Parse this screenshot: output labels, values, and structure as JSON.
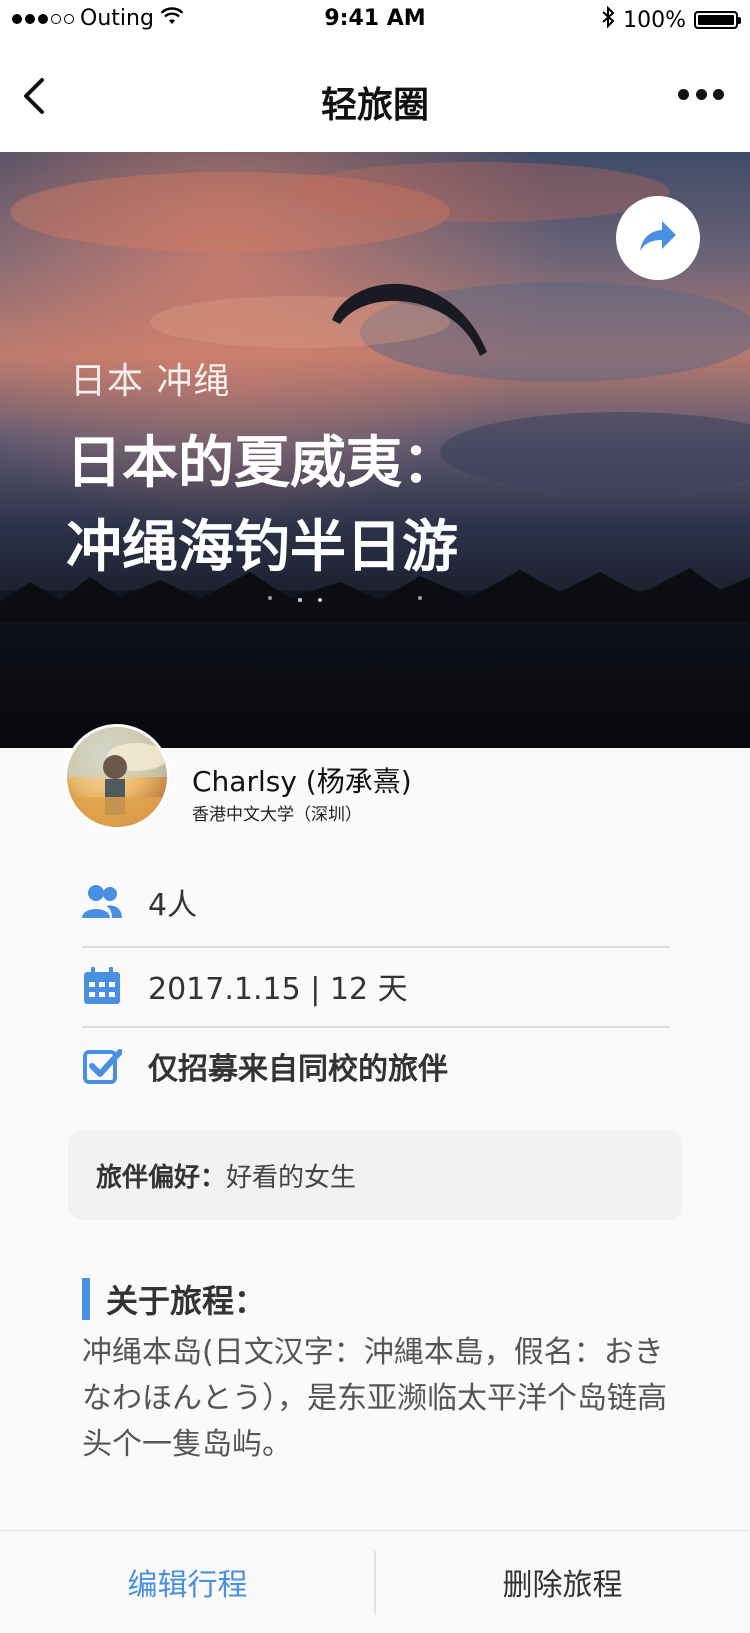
{
  "status_bar": {
    "carrier": "Outing",
    "time": "9:41 AM",
    "battery": "100%",
    "battery_level": 1.0
  },
  "nav": {
    "title": "轻旅圈",
    "back_icon": "chevron-left-icon",
    "more_icon": "more-dots-icon"
  },
  "hero": {
    "location": "日本 冲绳",
    "title_line1": "日本的夏威夷：",
    "title_line2": "冲绳海钓半日游",
    "share_icon": "share-icon"
  },
  "author": {
    "name": "Charlsy (杨承熹)",
    "school": "香港中文大学（深圳）"
  },
  "details": {
    "people": "4人",
    "date": "2017.1.15 | 12 天",
    "restriction": "仅招募来自同校的旅伴"
  },
  "preference": {
    "label": "旅伴偏好：",
    "value": "好看的女生"
  },
  "about": {
    "title": "关于旅程：",
    "text": "冲绳本岛(日文汉字：沖縄本島，假名：おきなわほんとう），是东亚濒临太平洋个岛链高头个一隻岛屿。"
  },
  "actions": {
    "edit": "编辑行程",
    "delete": "删除旅程"
  },
  "colors": {
    "accent": "#4a90e2"
  }
}
